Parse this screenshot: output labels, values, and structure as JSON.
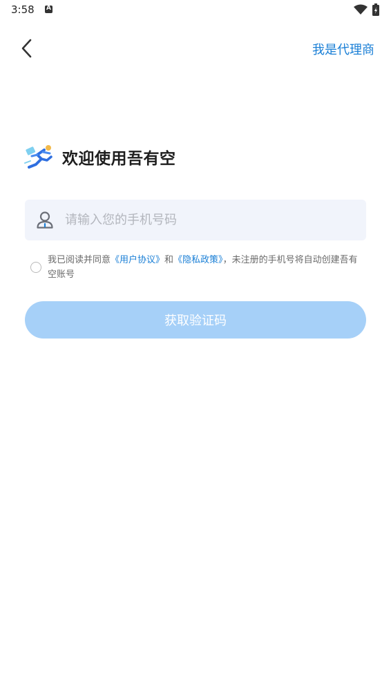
{
  "status_bar": {
    "time": "3:58",
    "icons": [
      "a-notification-icon",
      "wifi-icon",
      "battery-icon"
    ]
  },
  "header": {
    "back_icon": "chevron-left-icon",
    "agent_link": "我是代理商"
  },
  "welcome": {
    "logo_icon": "running-man-logo-icon",
    "title": "欢迎使用吾有空"
  },
  "phone_field": {
    "icon": "user-icon",
    "placeholder": "请输入您的手机号码",
    "value": ""
  },
  "agreement": {
    "prefix": "我已阅读并同意",
    "user_agreement": "《用户协议》",
    "and": "和",
    "privacy_policy": "《隐私政策》",
    "suffix": "，未注册的手机号将自动创建吾有空账号",
    "checked": false
  },
  "actions": {
    "get_code": "获取验证码"
  },
  "colors": {
    "accent": "#1a7fd6",
    "button_disabled": "#a6d0f8",
    "input_bg": "#f1f4fb"
  }
}
